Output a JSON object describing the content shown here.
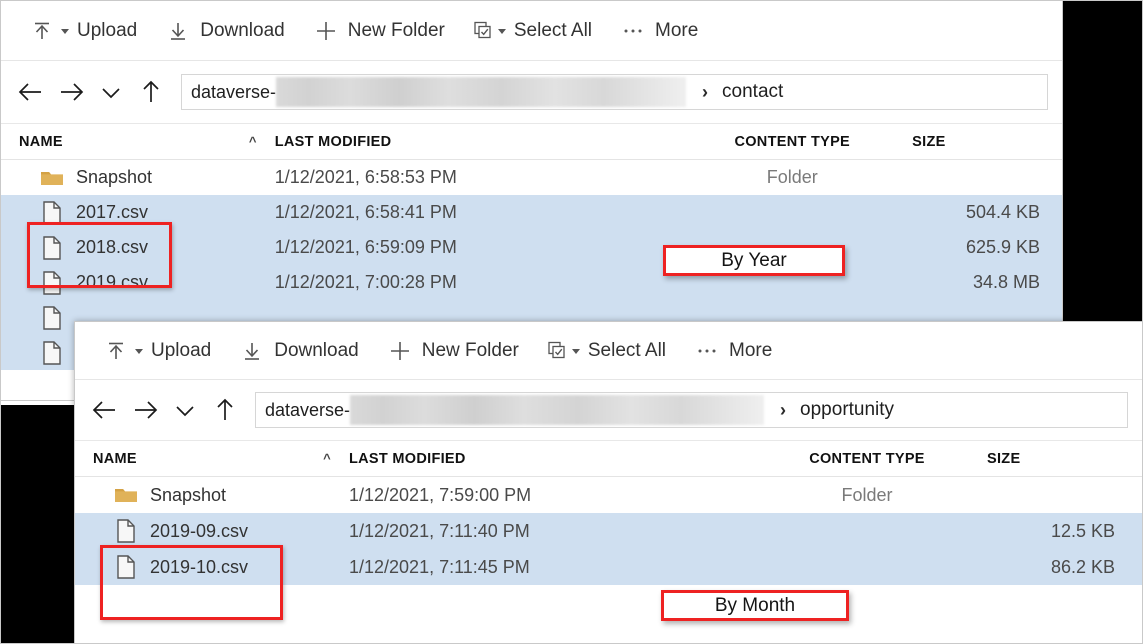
{
  "theme": {
    "selection_blue": "#cfdff0",
    "highlight_red": "#ee2222",
    "folder_gold": "#e0b259",
    "text_primary": "#333333",
    "text_muted": "#7a7a7a",
    "backdrop_black": "#000000"
  },
  "window_contact": {
    "toolbar": {
      "upload": "Upload",
      "download": "Download",
      "new_folder": "New Folder",
      "select_all": "Select All",
      "more": "More",
      "icons": {
        "upload": "upload-arrow-icon",
        "download": "download-arrow-icon",
        "new_folder": "plus-icon",
        "select_all": "select-all-checkbox-icon",
        "more": "ellipsis-icon"
      }
    },
    "nav": {
      "back": "back-arrow-icon",
      "forward": "forward-arrow-icon",
      "recent": "chevron-down-icon",
      "up": "up-arrow-icon"
    },
    "breadcrumb": {
      "prefix": "dataverse-",
      "blurred": "",
      "separator": "›",
      "current": "contact"
    },
    "columns": {
      "name": "NAME",
      "last_modified": "LAST MODIFIED",
      "content_type": "CONTENT TYPE",
      "size": "SIZE",
      "sort_indicator": "^"
    },
    "rows": [
      {
        "icon": "folder-icon",
        "name": "Snapshot",
        "modified": "1/12/2021, 6:58:53 PM",
        "type": "Folder",
        "size": "",
        "selected": false
      },
      {
        "icon": "file-icon",
        "name": "2017.csv",
        "modified": "1/12/2021, 6:58:41 PM",
        "type": "",
        "size": "504.4 KB",
        "selected": true
      },
      {
        "icon": "file-icon",
        "name": "2018.csv",
        "modified": "1/12/2021, 6:59:09 PM",
        "type": "",
        "size": "625.9 KB",
        "selected": true
      },
      {
        "icon": "file-icon",
        "name": "2019.csv",
        "modified": "1/12/2021, 7:00:28 PM",
        "type": "",
        "size": "34.8 MB",
        "selected": true
      },
      {
        "icon": "file-icon",
        "name": "",
        "modified": "",
        "type": "",
        "size": "",
        "selected": true
      },
      {
        "icon": "file-icon",
        "name": "",
        "modified": "",
        "type": "",
        "size": "",
        "selected": true
      }
    ],
    "callout": "By Year"
  },
  "window_opportunity": {
    "toolbar": {
      "upload": "Upload",
      "download": "Download",
      "new_folder": "New Folder",
      "select_all": "Select All",
      "more": "More",
      "icons": {
        "upload": "upload-arrow-icon",
        "download": "download-arrow-icon",
        "new_folder": "plus-icon",
        "select_all": "select-all-checkbox-icon",
        "more": "ellipsis-icon"
      }
    },
    "nav": {
      "back": "back-arrow-icon",
      "forward": "forward-arrow-icon",
      "recent": "chevron-down-icon",
      "up": "up-arrow-icon"
    },
    "breadcrumb": {
      "prefix": "dataverse-",
      "blurred": "",
      "separator": "›",
      "current": "opportunity"
    },
    "columns": {
      "name": "NAME",
      "last_modified": "LAST MODIFIED",
      "content_type": "CONTENT TYPE",
      "size": "SIZE",
      "sort_indicator": "^"
    },
    "rows": [
      {
        "icon": "folder-icon",
        "name": "Snapshot",
        "modified": "1/12/2021, 7:59:00 PM",
        "type": "Folder",
        "size": "",
        "selected": false
      },
      {
        "icon": "file-icon",
        "name": "2019-09.csv",
        "modified": "1/12/2021, 7:11:40 PM",
        "type": "",
        "size": "12.5 KB",
        "selected": true
      },
      {
        "icon": "file-icon",
        "name": "2019-10.csv",
        "modified": "1/12/2021, 7:11:45 PM",
        "type": "",
        "size": "86.2 KB",
        "selected": true
      }
    ],
    "callout": "By Month"
  }
}
